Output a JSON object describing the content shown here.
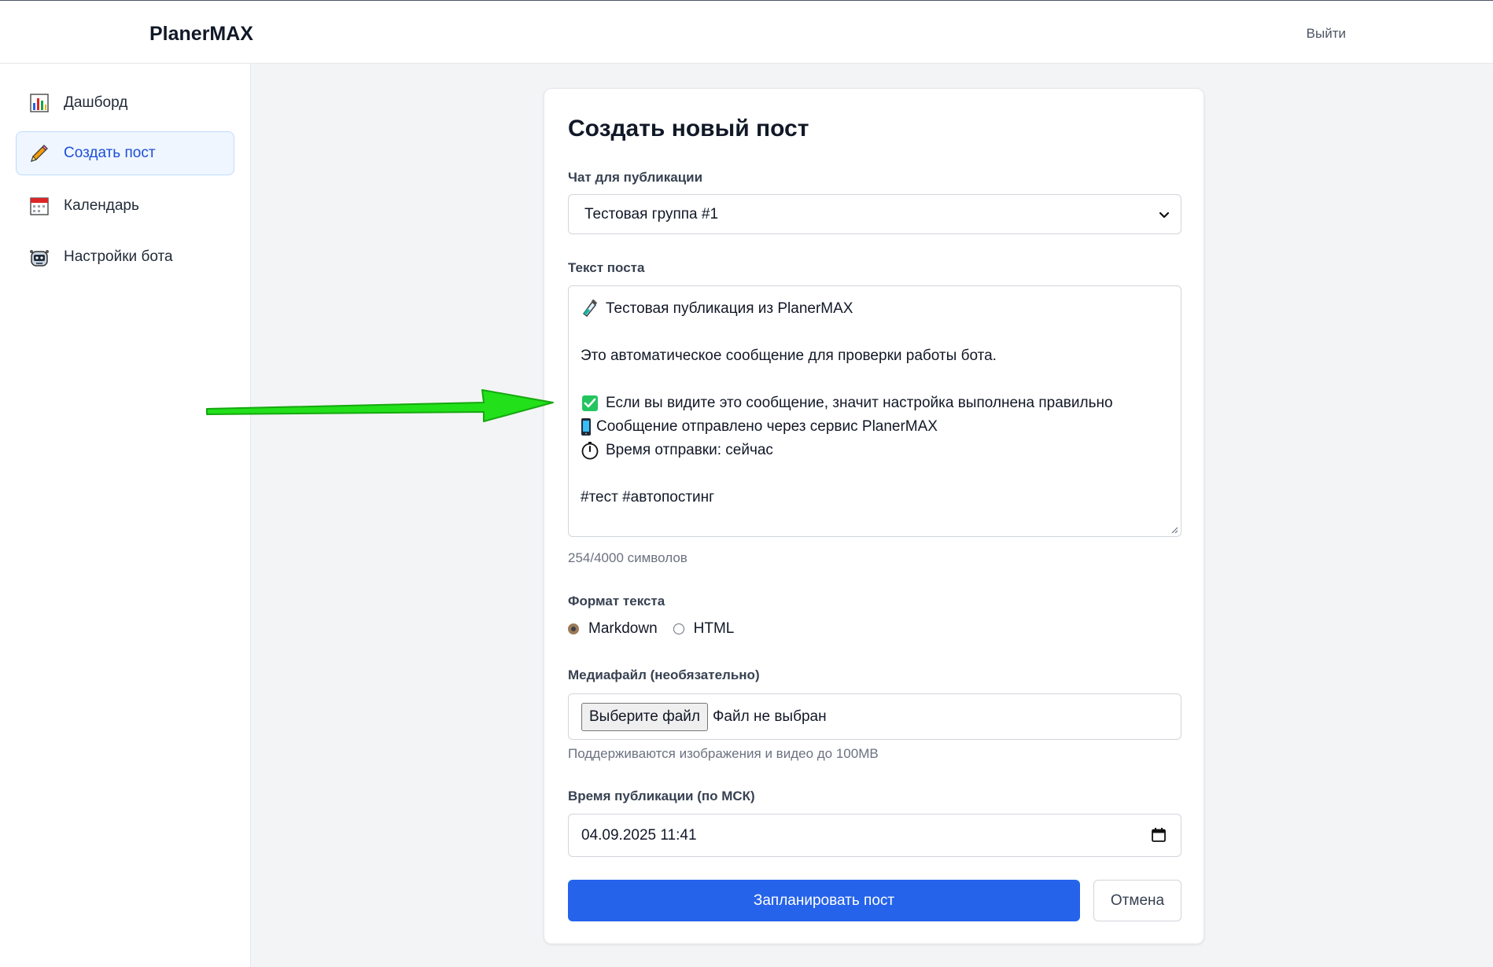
{
  "header": {
    "brand": "PlanerMAX",
    "logout_label": "Выйти"
  },
  "sidebar": {
    "items": [
      {
        "label": "Дашборд",
        "icon": "bar-chart-icon",
        "active": false
      },
      {
        "label": "Создать пост",
        "icon": "pencil-icon",
        "active": true
      },
      {
        "label": "Календарь",
        "icon": "calendar-icon",
        "active": false
      },
      {
        "label": "Настройки бота",
        "icon": "robot-icon",
        "active": false
      }
    ]
  },
  "form": {
    "title": "Создать новый пост",
    "chat": {
      "label": "Чат для публикации",
      "selected": "Тестовая группа #1"
    },
    "text": {
      "label": "Текст поста",
      "lines": [
        {
          "icon": "test-tube-icon",
          "text": "Тестовая публикация из PlanerMAX"
        },
        {
          "icon": "",
          "text": ""
        },
        {
          "icon": "",
          "text": "Это автоматическое сообщение для проверки работы бота."
        },
        {
          "icon": "",
          "text": ""
        },
        {
          "icon": "check-mark-icon",
          "text": "Если вы видите это сообщение, значит настройка выполнена правильно"
        },
        {
          "icon": "phone-icon",
          "text": "Сообщение отправлено через сервис PlanerMAX"
        },
        {
          "icon": "stopwatch-icon",
          "text": "Время отправки: сейчас"
        },
        {
          "icon": "",
          "text": ""
        },
        {
          "icon": "",
          "text": "#тест #автопостинг"
        }
      ],
      "counter": "254/4000 символов"
    },
    "format": {
      "label": "Формат текста",
      "options": [
        {
          "label": "Markdown",
          "selected": true
        },
        {
          "label": "HTML",
          "selected": false
        }
      ]
    },
    "media": {
      "label": "Медиафайл (необязательно)",
      "button_label": "Выберите файл",
      "file_status": "Файл не выбран",
      "hint": "Поддерживаются изображения и видео до 100MB"
    },
    "schedule": {
      "label": "Время публикации (по МСК)",
      "value": "04.09.2025 11:41"
    },
    "submit_label": "Запланировать пост",
    "cancel_label": "Отмена"
  },
  "colors": {
    "accent": "#2563eb",
    "annotation_arrow": "#22e01a"
  }
}
